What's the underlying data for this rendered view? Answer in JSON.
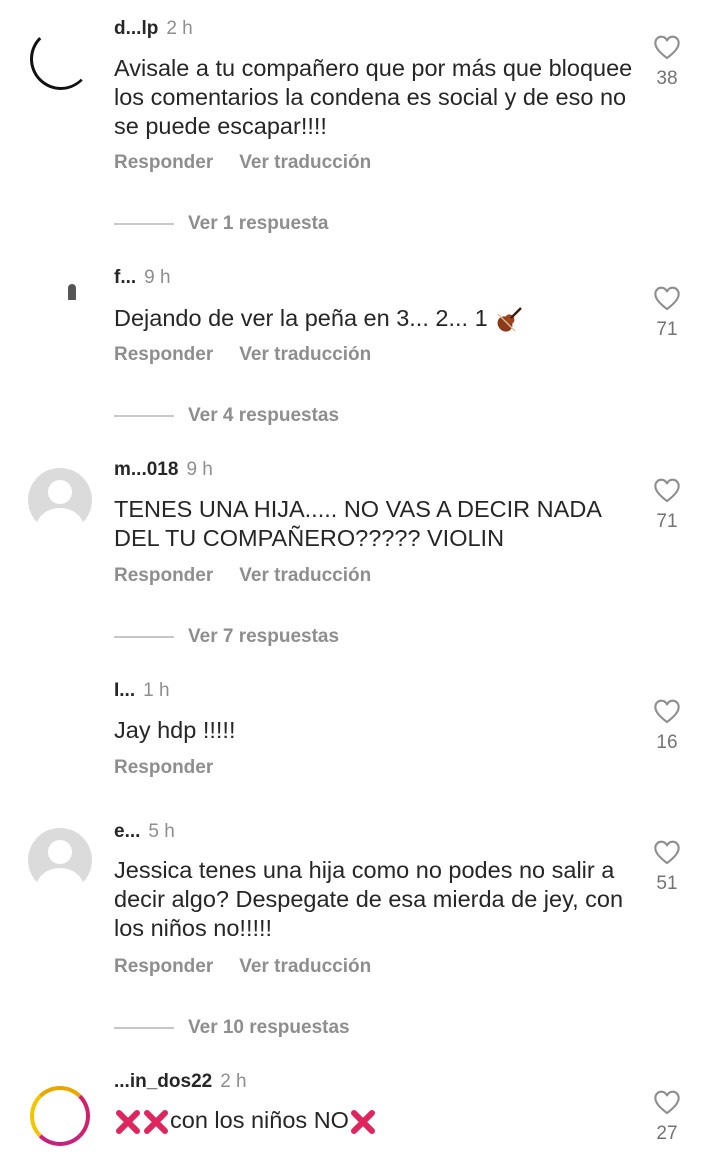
{
  "labels": {
    "reply": "Responder",
    "translate": "Ver traducción"
  },
  "comments": [
    {
      "username": "d...lp",
      "time": "2 h",
      "text": "Avisale a tu compañero que por más que bloquee los comentarios la condena es social y de eso no se puede escapar!!!!",
      "likes": "38",
      "replies": "Ver 1 respuesta",
      "avatar": "photo"
    },
    {
      "username": "f...",
      "time": "9 h",
      "text": "Dejando de ver la peña en 3... 2... 1",
      "emoji_after": "violin-emoji",
      "likes": "71",
      "replies": "Ver 4 respuestas",
      "avatar": "photo2"
    },
    {
      "username": "m...018",
      "time": "9 h",
      "text": "TENES UNA HIJA..... NO VAS A DECIR NADA DEL TU COMPAÑERO????? VIOLIN",
      "likes": "71",
      "replies": "Ver 7 respuestas",
      "avatar": "default"
    },
    {
      "username": "I...",
      "time": "1 h",
      "text": "Jay hdp !!!!!",
      "likes": "16",
      "avatar": "blank"
    },
    {
      "username": "e...",
      "time": "5 h",
      "text": "Jessica tenes una hija como no podes no salir a decir algo? Despegate de esa mierda de jey, con los niños no!!!!!",
      "likes": "51",
      "replies": "Ver 10 respuestas",
      "avatar": "default"
    },
    {
      "username": "...in_dos22",
      "time": "2 h",
      "text": "con los niños NO",
      "likes": "27",
      "avatar": "photo3"
    }
  ],
  "colors": {
    "text": "#262626",
    "secondary": "#8e8e8e",
    "heart_outline": "#8e8e8e",
    "cross_emoji": "#e0245e"
  }
}
